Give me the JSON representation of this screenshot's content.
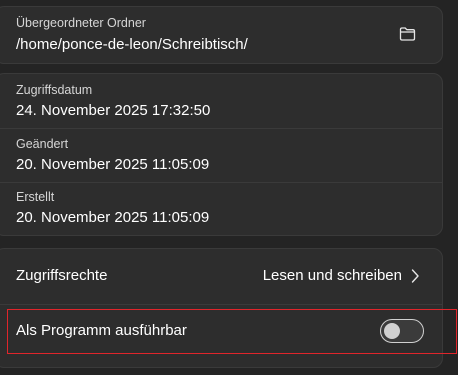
{
  "parent_folder": {
    "label": "Übergeordneter Ordner",
    "path": "/home/ponce-de-leon/Schreibtisch/",
    "open_icon": "folder-icon"
  },
  "dates": {
    "accessed_label": "Zugriffsdatum",
    "accessed_value": "24. November 2025 17:32:50",
    "modified_label": "Geändert",
    "modified_value": "20. November 2025 11:05:09",
    "created_label": "Erstellt",
    "created_value": "20. November 2025 11:05:09"
  },
  "permissions": {
    "access_label": "Zugriffsrechte",
    "access_value": "Lesen und schreiben",
    "access_icon": "chevron-right-icon",
    "executable_label": "Als Programm ausführbar",
    "executable_on": false
  },
  "colors": {
    "background": "#242424",
    "card": "#2d2d2d",
    "highlight": "#e0252b"
  }
}
